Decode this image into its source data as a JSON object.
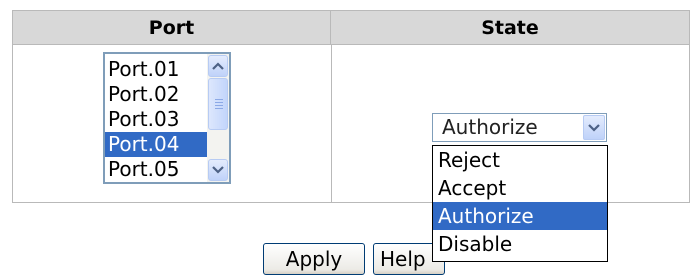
{
  "table": {
    "headers": {
      "port": "Port",
      "state": "State"
    }
  },
  "port_list": {
    "items": [
      "Port.01",
      "Port.02",
      "Port.03",
      "Port.04",
      "Port.05"
    ],
    "selected": "Port.04"
  },
  "state_select": {
    "value": "Authorize",
    "options": [
      "Reject",
      "Accept",
      "Authorize",
      "Disable"
    ],
    "highlighted": "Authorize"
  },
  "buttons": {
    "apply": "Apply",
    "help": "Help"
  },
  "colors": {
    "header_bg": "#d8d8d8",
    "selection": "#316ac5",
    "border": "#7f9db9"
  }
}
